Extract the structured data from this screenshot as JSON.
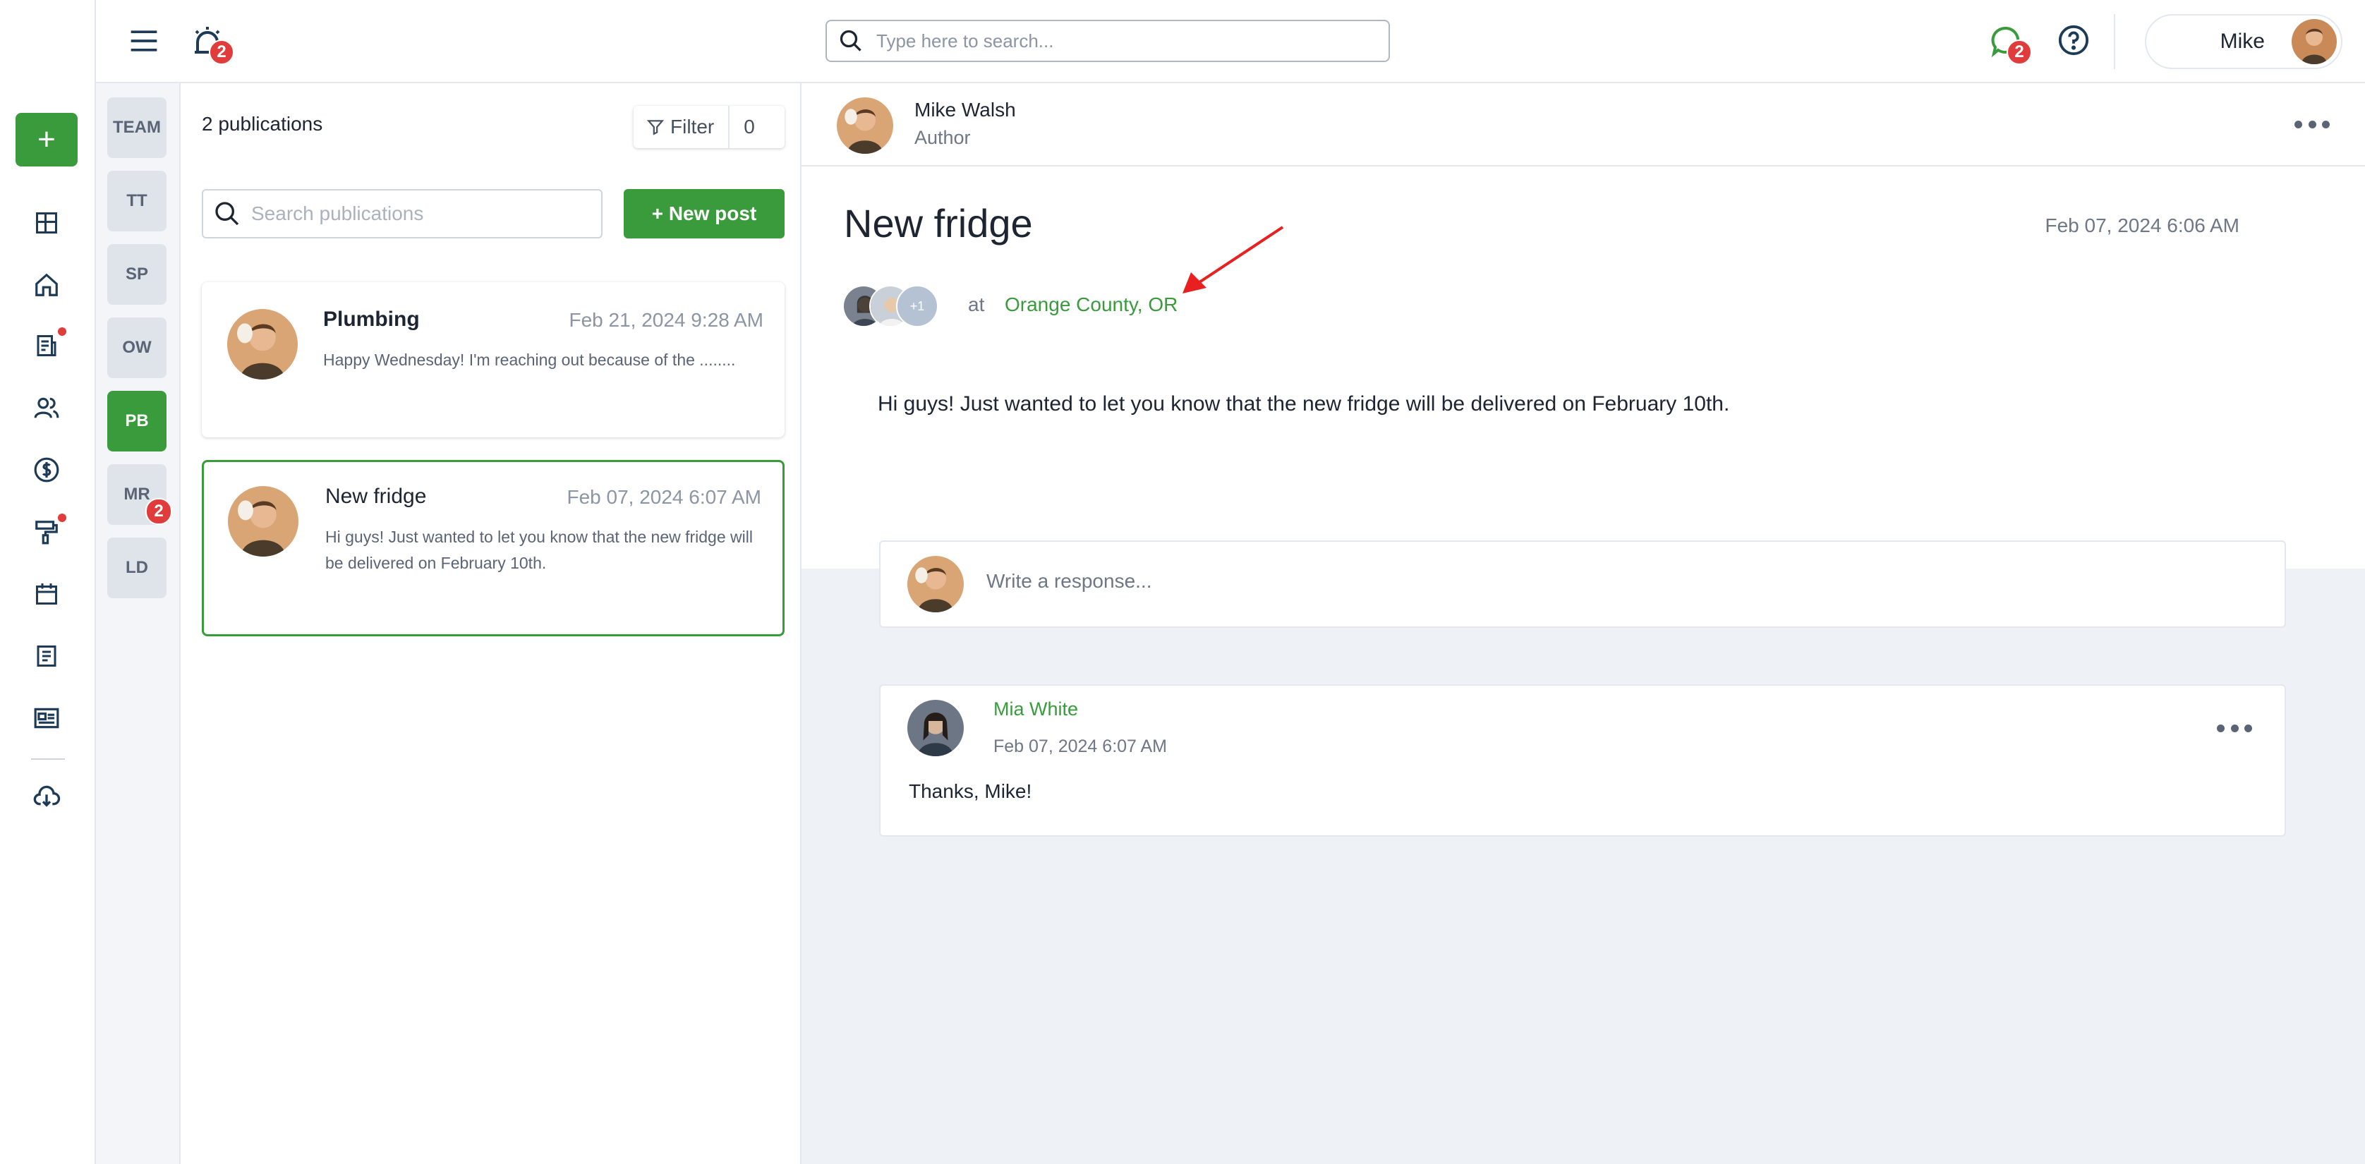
{
  "colors": {
    "accent": "#3a9b3d",
    "badge": "#e03c3c",
    "annotation_arrow": "#e8201f"
  },
  "header": {
    "notifications_count": "2",
    "search_placeholder": "Type here to search...",
    "messages_count": "2",
    "user_name": "Mike"
  },
  "rail": {
    "icons": [
      "plus-icon",
      "dashboard-icon",
      "home-icon",
      "report-icon",
      "users-icon",
      "dollar-icon",
      "paint-roller-icon",
      "calendar-icon",
      "document-icon",
      "newspaper-icon",
      "cloud-download-icon"
    ]
  },
  "teams": [
    {
      "code": "TEAM",
      "active": false
    },
    {
      "code": "TT",
      "active": false
    },
    {
      "code": "SP",
      "active": false
    },
    {
      "code": "OW",
      "active": false
    },
    {
      "code": "PB",
      "active": true
    },
    {
      "code": "MR",
      "active": false,
      "badge": "2"
    },
    {
      "code": "LD",
      "active": false
    }
  ],
  "list": {
    "count_label": "2 publications",
    "filter_label": "Filter",
    "filter_count": "0",
    "search_placeholder": "Search publications",
    "new_post_label": "+ New post",
    "cards": [
      {
        "title": "Plumbing",
        "date": "Feb 21, 2024 9:28 AM",
        "body": "Happy Wednesday! I'm reaching out because of the ........",
        "selected": false
      },
      {
        "title": "New fridge",
        "date": "Feb 07, 2024 6:07 AM",
        "body": "Hi guys! Just wanted to let you know that the new fridge will be delivered on February 10th.",
        "selected": true
      }
    ]
  },
  "post": {
    "author_name": "Mike Walsh",
    "author_role": "Author",
    "title": "New fridge",
    "date": "Feb 07, 2024 6:06 AM",
    "extra_recipients": "+1",
    "at_word": "at",
    "location": "Orange County, OR",
    "text": "Hi guys! Just wanted to let you know that the new fridge will be delivered on February 10th.",
    "reply_placeholder": "Write a response..."
  },
  "comments": [
    {
      "author": "Mia White",
      "date": "Feb 07, 2024 6:07 AM",
      "text": "Thanks, Mike!"
    }
  ]
}
